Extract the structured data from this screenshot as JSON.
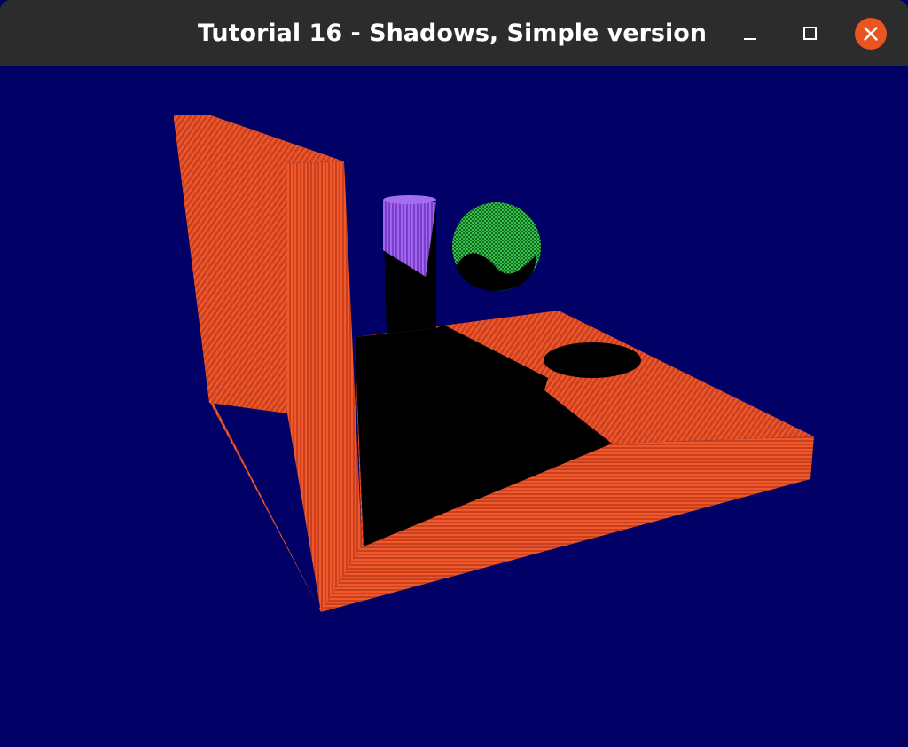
{
  "window": {
    "title": "Tutorial 16 - Shadows, Simple version",
    "controls": [
      "minimize-icon",
      "maximize-icon",
      "close-icon"
    ]
  },
  "colors": {
    "titlebar": "#2c2c2c",
    "title_text": "#ffffff",
    "close_button": "#e95420",
    "background": "#000066",
    "floor_and_wall": "#e2502a",
    "cylinder": "#8a4fd8",
    "sphere": "#1f9a32",
    "shadow": "#000000"
  },
  "scene": {
    "objects": [
      "wall",
      "floor",
      "cylinder",
      "sphere"
    ]
  }
}
